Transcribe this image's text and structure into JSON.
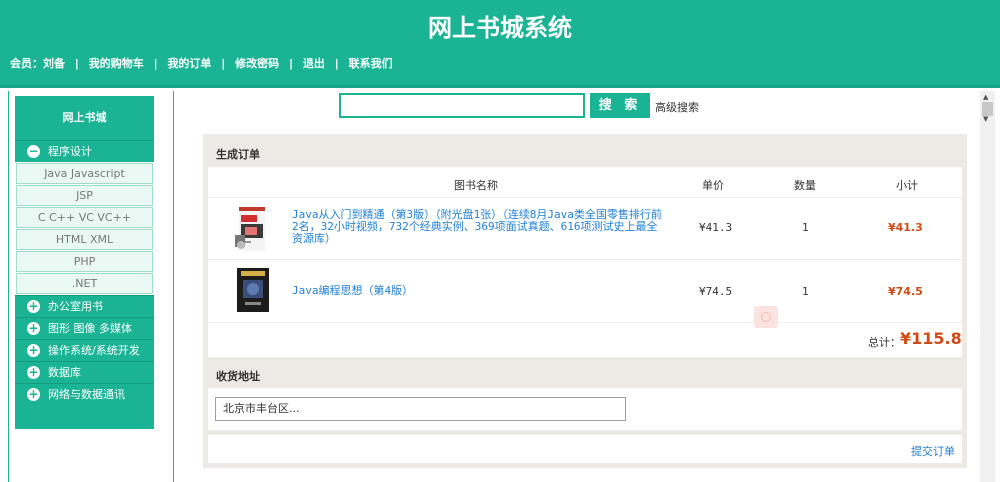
{
  "header": {
    "title": "网上书城系统",
    "nav": {
      "member_label": "会员：",
      "member_name": "刘备",
      "cart": "我的购物车",
      "orders": "我的订单",
      "change_password": "修改密码",
      "logout": "退出",
      "contact": "联系我们",
      "separator": "|"
    }
  },
  "sidebar": {
    "title": "网上书城",
    "categories": [
      {
        "label": "程序设计",
        "icon": "minus-circle-icon",
        "expanded": true,
        "items": [
          "Java Javascript",
          "JSP",
          "C C++ VC VC++",
          "HTML XML",
          "PHP",
          ".NET"
        ]
      },
      {
        "label": "办公室用书",
        "icon": "plus-circle-icon"
      },
      {
        "label": "图形 图像 多媒体",
        "icon": "plus-circle-icon"
      },
      {
        "label": "操作系统/系统开发",
        "icon": "plus-circle-icon"
      },
      {
        "label": "数据库",
        "icon": "plus-circle-icon"
      },
      {
        "label": "网络与数据通讯",
        "icon": "plus-circle-icon"
      }
    ]
  },
  "search": {
    "value": "",
    "button_label": "搜 索",
    "advanced_label": "高级搜索"
  },
  "order": {
    "title": "生成订单",
    "columns": {
      "name": "图书名称",
      "price": "单价",
      "qty": "数量",
      "subtotal": "小计"
    },
    "items": [
      {
        "name": "Java从入门到精通（第3版）（附光盘1张）（连续8月Java类全国零售排行前2名，32小时视频，732个经典实例、369项面试真题、616项测试史上最全资源库）",
        "price": "¥41.3",
        "qty": "1",
        "subtotal": "¥41.3"
      },
      {
        "name": "Java编程思想（第4版）",
        "price": "¥74.5",
        "qty": "1",
        "subtotal": "¥74.5"
      }
    ],
    "total_label": "总计：",
    "total_value": "¥115.8"
  },
  "address": {
    "title": "收货地址",
    "value": "北京市丰台区..."
  },
  "submit_label": "提交订单",
  "colors": {
    "accent": "#1ab394",
    "price_red": "#d04a17",
    "link_blue": "#1f7fd6",
    "panel_bg": "#ede9e4"
  }
}
